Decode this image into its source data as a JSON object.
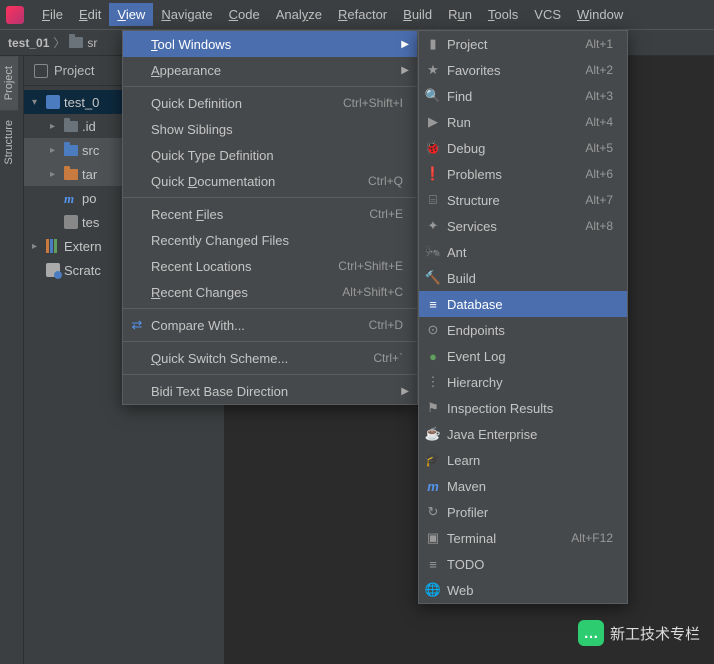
{
  "menubar": [
    "File",
    "Edit",
    "View",
    "Navigate",
    "Code",
    "Analyze",
    "Refactor",
    "Build",
    "Run",
    "Tools",
    "VCS",
    "Window"
  ],
  "menubar_underline": [
    0,
    0,
    0,
    0,
    0,
    4,
    0,
    0,
    1,
    0,
    -1,
    0
  ],
  "menubar_open_index": 2,
  "breadcrumb": {
    "project": "test_01",
    "folder_prefix": "sr"
  },
  "side_tabs": [
    {
      "label": "Project",
      "active": true
    },
    {
      "label": "Structure",
      "active": false
    }
  ],
  "panel_title": "Project",
  "tree": [
    {
      "depth": 0,
      "exp": "down",
      "icon": "mod",
      "label": "test_0",
      "sel": true
    },
    {
      "depth": 1,
      "exp": "right",
      "icon": "folder",
      "label": ".id"
    },
    {
      "depth": 1,
      "exp": "right",
      "icon": "folder-blue",
      "label": "src",
      "hl": true
    },
    {
      "depth": 1,
      "exp": "right",
      "icon": "folder-orange",
      "label": "tar",
      "hl": true
    },
    {
      "depth": 1,
      "exp": "",
      "icon": "m",
      "label": "po"
    },
    {
      "depth": 1,
      "exp": "",
      "icon": "db",
      "label": "tes"
    },
    {
      "depth": 0,
      "exp": "right",
      "icon": "lib",
      "label": "Extern"
    },
    {
      "depth": 0,
      "exp": "",
      "icon": "scratch",
      "label": "Scratc"
    }
  ],
  "view_menu": [
    {
      "label": "Tool Windows",
      "u": 0,
      "arrow": true,
      "hover": true
    },
    {
      "label": "Appearance",
      "u": 0,
      "arrow": true
    },
    {
      "sep": true
    },
    {
      "label": "Quick Definition",
      "shortcut": "Ctrl+Shift+I"
    },
    {
      "label": "Show Siblings"
    },
    {
      "label": "Quick Type Definition"
    },
    {
      "label": "Quick Documentation",
      "u": 6,
      "shortcut": "Ctrl+Q"
    },
    {
      "sep": true
    },
    {
      "label": "Recent Files",
      "u": 7,
      "shortcut": "Ctrl+E"
    },
    {
      "label": "Recently Changed Files"
    },
    {
      "label": "Recent Locations",
      "shortcut": "Ctrl+Shift+E"
    },
    {
      "label": "Recent Changes",
      "u": 0,
      "shortcut": "Alt+Shift+C"
    },
    {
      "sep": true
    },
    {
      "label": "Compare With...",
      "icon": "cmp",
      "shortcut": "Ctrl+D"
    },
    {
      "sep": true
    },
    {
      "label": "Quick Switch Scheme...",
      "u": 0,
      "shortcut": "Ctrl+`"
    },
    {
      "sep": true
    },
    {
      "label": "Bidi Text Base Direction",
      "arrow": true
    }
  ],
  "tool_windows": [
    {
      "icon": "folder",
      "label": "Project",
      "shortcut": "Alt+1"
    },
    {
      "icon": "star",
      "label": "Favorites",
      "shortcut": "Alt+2"
    },
    {
      "icon": "find",
      "label": "Find",
      "shortcut": "Alt+3"
    },
    {
      "icon": "run",
      "label": "Run",
      "shortcut": "Alt+4"
    },
    {
      "icon": "bug",
      "label": "Debug",
      "shortcut": "Alt+5"
    },
    {
      "icon": "warn",
      "label": "Problems",
      "shortcut": "Alt+6"
    },
    {
      "icon": "struct",
      "label": "Structure",
      "shortcut": "Alt+7"
    },
    {
      "icon": "svc",
      "label": "Services",
      "shortcut": "Alt+8"
    },
    {
      "icon": "ant",
      "label": "Ant"
    },
    {
      "icon": "build",
      "label": "Build"
    },
    {
      "icon": "db",
      "label": "Database",
      "hover": true
    },
    {
      "icon": "ep",
      "label": "Endpoints"
    },
    {
      "icon": "log",
      "label": "Event Log"
    },
    {
      "icon": "hier",
      "label": "Hierarchy"
    },
    {
      "icon": "insp",
      "label": "Inspection Results"
    },
    {
      "icon": "jee",
      "label": "Java Enterprise"
    },
    {
      "icon": "learn",
      "label": "Learn"
    },
    {
      "icon": "mvn",
      "label": "Maven"
    },
    {
      "icon": "prof",
      "label": "Profiler"
    },
    {
      "icon": "term",
      "label": "Terminal",
      "shortcut": "Alt+F12"
    },
    {
      "icon": "todo",
      "label": "TODO"
    },
    {
      "icon": "web",
      "label": "Web"
    }
  ],
  "watermark": "新工技术专栏"
}
